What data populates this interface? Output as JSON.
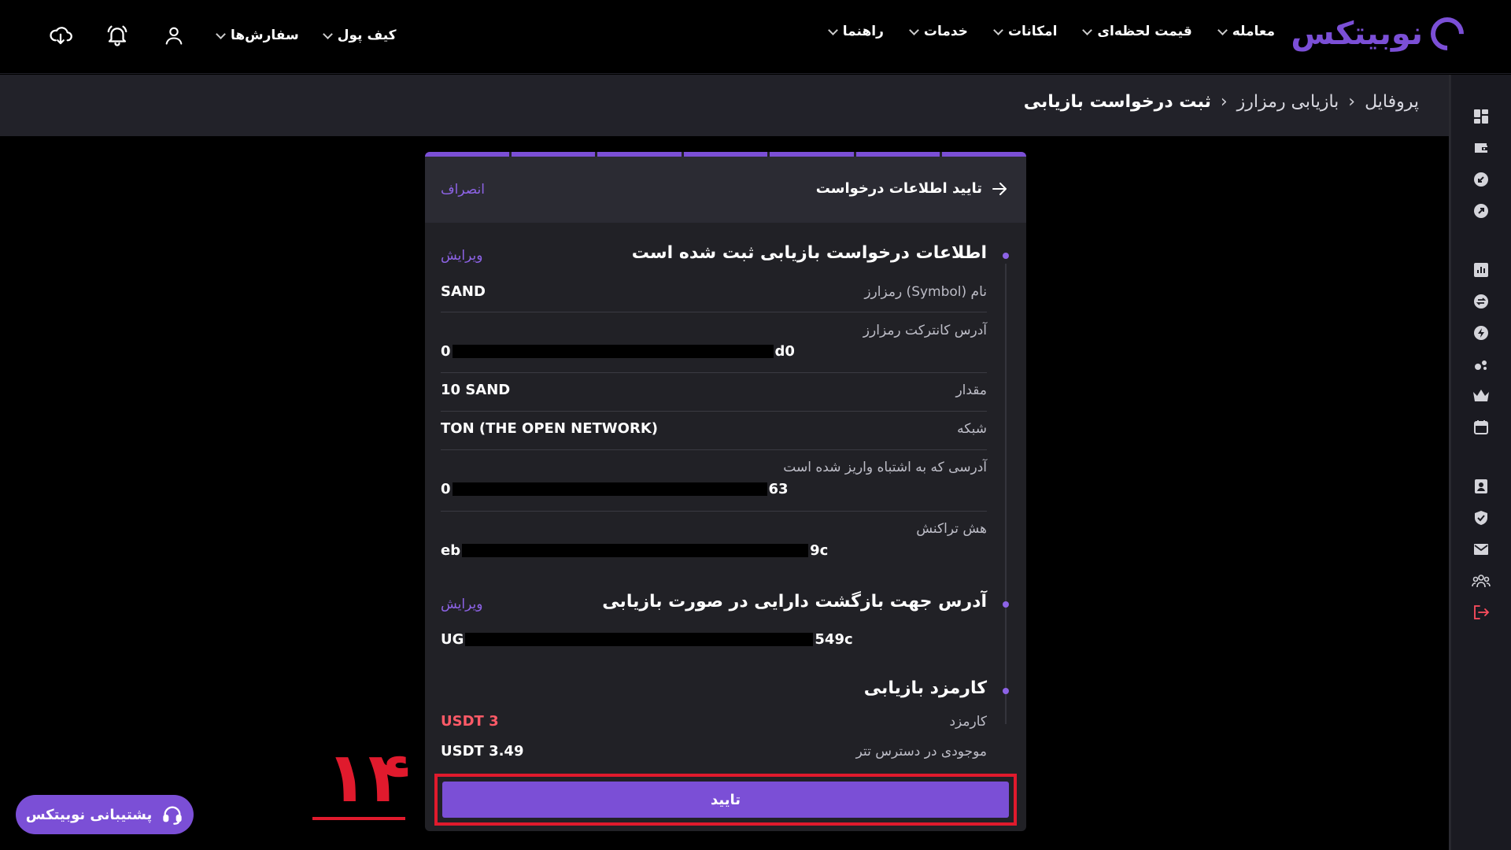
{
  "brand": {
    "name": "نوبیتکس",
    "color": "#7b4fd6"
  },
  "nav": {
    "items": [
      {
        "label": "معامله"
      },
      {
        "label": "قیمت لحظه‌ای"
      },
      {
        "label": "امکانات"
      },
      {
        "label": "خدمات"
      },
      {
        "label": "راهنما"
      }
    ],
    "left_items": [
      {
        "label": "سفارش‌ها"
      },
      {
        "label": "کیف پول"
      }
    ],
    "icons": [
      "user-icon",
      "bell-icon",
      "download-cloud-icon"
    ]
  },
  "breadcrumb": {
    "items": [
      "پروفایل",
      "بازیابی رمزارز",
      "ثبت درخواست بازیابی"
    ]
  },
  "sidebar": {
    "icons": [
      "dashboard-icon",
      "wallet-icon",
      "deposit-icon",
      "withdraw-icon",
      "chart-icon",
      "exchange-icon",
      "bolt-icon",
      "coins-icon",
      "crown-icon",
      "calendar-icon",
      "profile-card-icon",
      "shield-check-icon",
      "mail-icon",
      "users-icon",
      "logout-icon"
    ]
  },
  "card": {
    "progress_steps": 7,
    "header_title": "تایید اطلاعات درخواست",
    "cancel_label": "انصراف",
    "section1": {
      "title": "اطلاعات درخواست بازیابی ثبت شده است",
      "edit_label": "ویرایش",
      "symbol_label": "نام (Symbol) رمزارز",
      "symbol_value": "SAND",
      "contract_label": "آدرس کانترکت رمزارز",
      "contract_start": "0",
      "contract_end": "d0",
      "amount_label": "مقدار",
      "amount_value": "10 SAND",
      "network_label": "شبکه",
      "network_value": "TON (THE OPEN NETWORK)",
      "wrong_addr_label": "آدرسی که به اشتباه واریز شده است",
      "wrong_addr_start": "0",
      "wrong_addr_end": "63",
      "hash_label": "هش تراکنش",
      "hash_start": "eb",
      "hash_end": "9c"
    },
    "section2": {
      "title": "آدرس جهت بازگشت دارایی در صورت بازیابی",
      "edit_label": "ویرایش",
      "addr_start": "UG",
      "addr_end": "549c"
    },
    "section3": {
      "title": "کارمزد بازیابی",
      "fee_label": "کارمزد",
      "fee_value": "USDT 3",
      "balance_label": "موجودی در دسترس تتر",
      "balance_value": "USDT 3.49"
    },
    "confirm_label": "تایید"
  },
  "annotation": {
    "number": "۱۴",
    "color": "#e01a2d"
  },
  "support": {
    "label": "پشتیبانی نوبیتکس"
  }
}
